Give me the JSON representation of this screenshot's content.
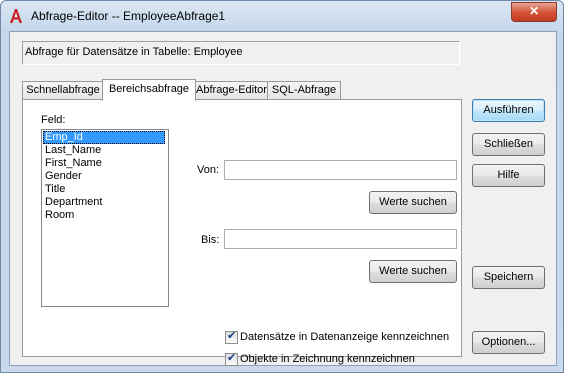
{
  "window": {
    "title": "Abfrage-Editor -- EmployeeAbfrage1",
    "close_label": "✕"
  },
  "info": {
    "text": "Abfrage für Datensätze in Tabelle:  Employee"
  },
  "tabs": [
    {
      "label": "Schnellabfrage"
    },
    {
      "label": "Bereichsabfrage"
    },
    {
      "label": "Abfrage-Editor"
    },
    {
      "label": "SQL-Abfrage"
    }
  ],
  "panel": {
    "field_label": "Feld:",
    "fields": [
      "Emp_Id",
      "Last_Name",
      "First_Name",
      "Gender",
      "Title",
      "Department",
      "Room"
    ],
    "selected_field": "Emp_Id",
    "from_label": "Von:",
    "from_value": "",
    "find_values_from": "Werte suchen",
    "to_label": "Bis:",
    "to_value": "",
    "find_values_to": "Werte suchen",
    "checkbox_mark_label": "Datensätze in Datenanzeige kennzeichnen",
    "checkbox_mark_checked": true,
    "checkbox_objects_label": "Objekte in Zeichnung kennzeichnen",
    "checkbox_objects_checked": true
  },
  "buttons": {
    "execute": "Ausführen",
    "close": "Schließen",
    "help": "Hilfe",
    "save": "Speichern",
    "options": "Optionen..."
  },
  "icons": {
    "app": "autocad-a-icon",
    "accent_color": "#cc1f1f"
  }
}
